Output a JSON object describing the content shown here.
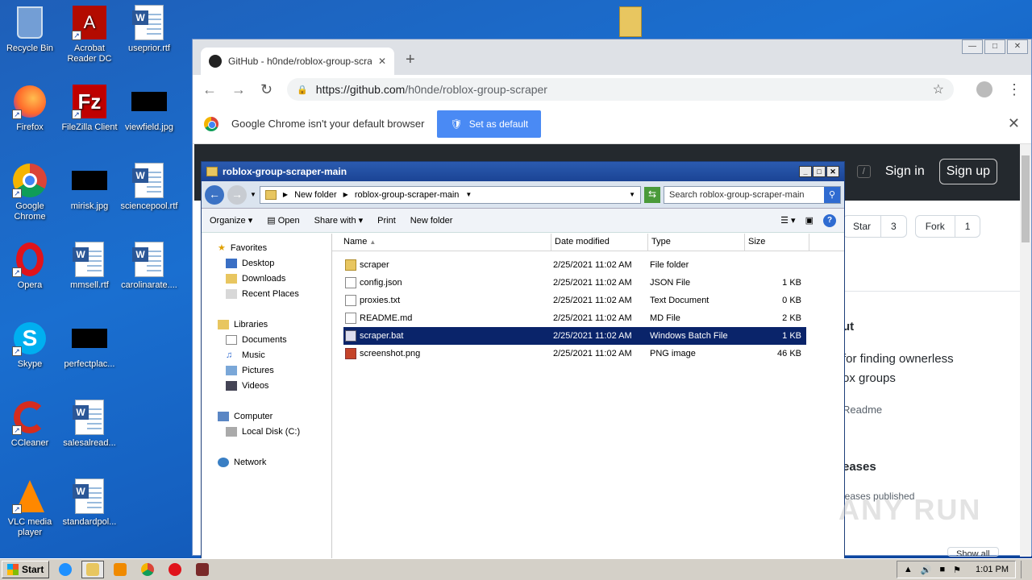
{
  "desktop": {
    "icons": [
      {
        "label": "Recycle Bin",
        "icon": "recycle-bin-icon"
      },
      {
        "label": "Acrobat Reader DC",
        "icon": "acrobat-icon"
      },
      {
        "label": "useprior.rtf",
        "icon": "word-doc-icon"
      },
      {
        "label": "Firefox",
        "icon": "firefox-icon"
      },
      {
        "label": "FileZilla Client",
        "icon": "filezilla-icon"
      },
      {
        "label": "viewfield.jpg",
        "icon": "image-icon"
      },
      {
        "label": "Google Chrome",
        "icon": "chrome-icon"
      },
      {
        "label": "mirisk.jpg",
        "icon": "image-icon"
      },
      {
        "label": "sciencepool.rtf",
        "icon": "word-doc-icon"
      },
      {
        "label": "Opera",
        "icon": "opera-icon"
      },
      {
        "label": "mmsell.rtf",
        "icon": "word-doc-icon"
      },
      {
        "label": "carolinarate....",
        "icon": "word-doc-icon"
      },
      {
        "label": "Skype",
        "icon": "skype-icon"
      },
      {
        "label": "perfectplac...",
        "icon": "image-icon"
      },
      {
        "label": "CCleaner",
        "icon": "ccleaner-icon"
      },
      {
        "label": "salesalread...",
        "icon": "word-doc-icon"
      },
      {
        "label": "VLC media player",
        "icon": "vlc-icon"
      },
      {
        "label": "standardpol...",
        "icon": "word-doc-icon"
      }
    ]
  },
  "chrome": {
    "tab_title": "GitHub - h0nde/roblox-group-scrape",
    "url_host": "https://github.com",
    "url_path": "/h0nde/roblox-group-scraper",
    "infobar_text": "Google Chrome isn't your default browser",
    "set_default_label": "Set as default",
    "github": {
      "slash": "/",
      "sign_in": "Sign in",
      "sign_up": "Sign up",
      "star_label": "Star",
      "star_count": "3",
      "fork_label": "Fork",
      "fork_count": "1",
      "about_fragment": "ut",
      "desc_line1": "for finding ownerless",
      "desc_line2": "ox groups",
      "readme": "Readme",
      "releases": "eases",
      "releases_sub": "leases published",
      "show_all": "Show all"
    }
  },
  "explorer": {
    "title": "roblox-group-scraper-main",
    "breadcrumb": [
      "New folder",
      "roblox-group-scraper-main"
    ],
    "search_placeholder": "Search roblox-group-scraper-main",
    "commands": {
      "organize": "Organize",
      "open": "Open",
      "share": "Share with",
      "print": "Print",
      "new_folder": "New folder"
    },
    "nav": {
      "favorites": "Favorites",
      "desktop": "Desktop",
      "downloads": "Downloads",
      "recent": "Recent Places",
      "libraries": "Libraries",
      "documents": "Documents",
      "music": "Music",
      "pictures": "Pictures",
      "videos": "Videos",
      "computer": "Computer",
      "local_disk": "Local Disk (C:)",
      "network": "Network"
    },
    "columns": {
      "name": "Name",
      "date": "Date modified",
      "type": "Type",
      "size": "Size"
    },
    "files": [
      {
        "name": "scraper",
        "date": "2/25/2021 11:02 AM",
        "type": "File folder",
        "size": ""
      },
      {
        "name": "config.json",
        "date": "2/25/2021 11:02 AM",
        "type": "JSON File",
        "size": "1 KB"
      },
      {
        "name": "proxies.txt",
        "date": "2/25/2021 11:02 AM",
        "type": "Text Document",
        "size": "0 KB"
      },
      {
        "name": "README.md",
        "date": "2/25/2021 11:02 AM",
        "type": "MD File",
        "size": "2 KB"
      },
      {
        "name": "scraper.bat",
        "date": "2/25/2021 11:02 AM",
        "type": "Windows Batch File",
        "size": "1 KB"
      },
      {
        "name": "screenshot.png",
        "date": "2/25/2021 11:02 AM",
        "type": "PNG image",
        "size": "46 KB"
      }
    ]
  },
  "taskbar": {
    "start_label": "Start",
    "clock": "1:01 PM"
  },
  "watermark": "ANY RUN"
}
